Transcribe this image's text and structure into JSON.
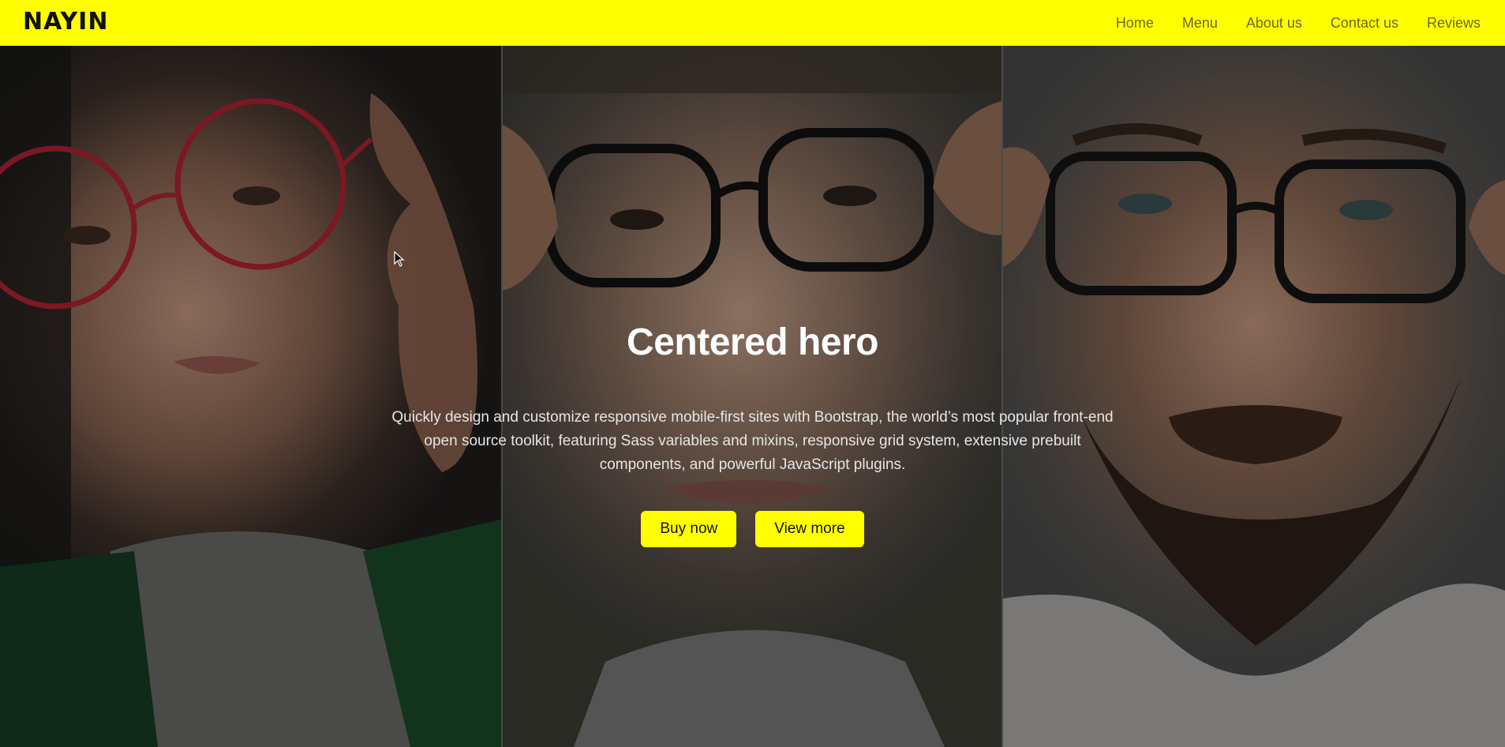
{
  "brand": {
    "logo_text": "NAYIN"
  },
  "nav": {
    "items": [
      {
        "label": "Home"
      },
      {
        "label": "Menu"
      },
      {
        "label": "About us"
      },
      {
        "label": "Contact us"
      },
      {
        "label": "Reviews"
      }
    ]
  },
  "hero": {
    "title": "Centered hero",
    "lead": "Quickly design and customize responsive mobile-first sites with Bootstrap, the world’s most popular front-end open source toolkit, featuring Sass variables and mixins, responsive grid system, extensive prebuilt components, and powerful JavaScript plugins.",
    "buttons": {
      "primary": "Buy now",
      "secondary": "View more"
    },
    "images": [
      {
        "icon": "portrait-woman-red-glasses",
        "accent": "#8b1e2a"
      },
      {
        "icon": "portrait-man-black-glasses",
        "accent": "#111111"
      },
      {
        "icon": "portrait-bearded-man-glasses",
        "accent": "#1a1a1a"
      }
    ]
  },
  "colors": {
    "accent": "#ffff00",
    "nav_text": "#6a6a28",
    "title": "#ffffff"
  }
}
